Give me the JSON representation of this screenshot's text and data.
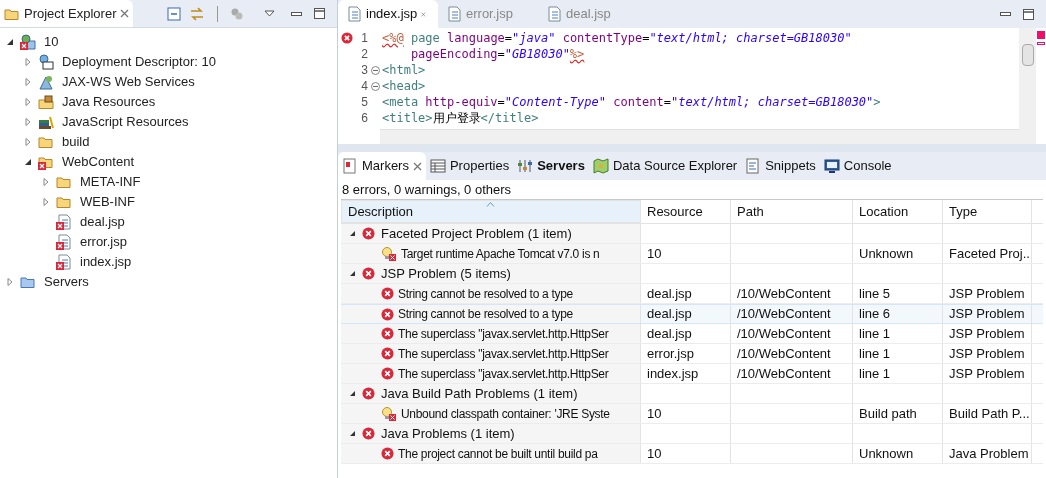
{
  "project_explorer": {
    "title": "Project Explorer",
    "tree": [
      {
        "label": "10",
        "kind": "project",
        "error": true,
        "expanded": true,
        "children": [
          {
            "label": "Deployment Descriptor: 10",
            "kind": "descriptor",
            "error": false,
            "expanded": false
          },
          {
            "label": "JAX-WS Web Services",
            "kind": "webservice",
            "error": false,
            "expanded": false
          },
          {
            "label": "Java Resources",
            "kind": "java-resources",
            "error": false,
            "expanded": false
          },
          {
            "label": "JavaScript Resources",
            "kind": "js-resources",
            "error": false,
            "expanded": false
          },
          {
            "label": "build",
            "kind": "folder",
            "error": false,
            "expanded": false
          },
          {
            "label": "WebContent",
            "kind": "folder",
            "error": true,
            "expanded": true,
            "children": [
              {
                "label": "META-INF",
                "kind": "folder",
                "error": false,
                "expanded": false
              },
              {
                "label": "WEB-INF",
                "kind": "folder",
                "error": false,
                "expanded": false
              },
              {
                "label": "deal.jsp",
                "kind": "file",
                "error": true
              },
              {
                "label": "error.jsp",
                "kind": "file",
                "error": true
              },
              {
                "label": "index.jsp",
                "kind": "file",
                "error": true
              }
            ]
          }
        ]
      },
      {
        "label": "Servers",
        "kind": "server-folder",
        "error": false,
        "expanded": false
      }
    ]
  },
  "editor": {
    "tabs": [
      {
        "label": "index.jsp",
        "selected": true
      },
      {
        "label": "error.jsp",
        "selected": false
      },
      {
        "label": "deal.jsp",
        "selected": false
      }
    ],
    "lines": [
      {
        "number": "1",
        "error": true,
        "fold": false,
        "tokens": [
          {
            "kind": "directive",
            "text": "<%@"
          },
          {
            "kind": "tag",
            "text": " page"
          },
          {
            "kind": "attr",
            "text": " language"
          },
          {
            "kind": "text",
            "text": "="
          },
          {
            "kind": "value",
            "text": "\"java\""
          },
          {
            "kind": "attr",
            "text": " contentType"
          },
          {
            "kind": "text",
            "text": "="
          },
          {
            "kind": "value",
            "text": "\"text/html; charset=GB18030\""
          }
        ]
      },
      {
        "number": "2",
        "error": false,
        "fold": false,
        "tokens": [
          {
            "kind": "attr",
            "text": "    pageEncoding"
          },
          {
            "kind": "text",
            "text": "="
          },
          {
            "kind": "value",
            "text": "\"GB18030\""
          },
          {
            "kind": "directive",
            "text": "%>"
          }
        ]
      },
      {
        "number": "3",
        "error": false,
        "fold": true,
        "tokens": [
          {
            "kind": "tag",
            "text": "<html>"
          }
        ]
      },
      {
        "number": "4",
        "error": false,
        "fold": true,
        "tokens": [
          {
            "kind": "tag",
            "text": "<head>"
          }
        ]
      },
      {
        "number": "5",
        "error": false,
        "fold": false,
        "tokens": [
          {
            "kind": "tag",
            "text": "<meta"
          },
          {
            "kind": "attr",
            "text": " http-equiv"
          },
          {
            "kind": "text",
            "text": "="
          },
          {
            "kind": "value",
            "text": "\"Content-Type\""
          },
          {
            "kind": "attr",
            "text": " content"
          },
          {
            "kind": "text",
            "text": "="
          },
          {
            "kind": "value",
            "text": "\"text/html; charset=GB18030\""
          },
          {
            "kind": "tag",
            "text": ">"
          }
        ]
      },
      {
        "number": "6",
        "error": false,
        "fold": false,
        "tokens": [
          {
            "kind": "tag",
            "text": "<title>"
          },
          {
            "kind": "text",
            "text": "用户登录"
          },
          {
            "kind": "tag",
            "text": "</title>"
          }
        ]
      }
    ]
  },
  "views": {
    "tabs": [
      {
        "label": "Markers",
        "kind": "markers",
        "selected": true,
        "highlighted": false
      },
      {
        "label": "Properties",
        "kind": "properties",
        "selected": false,
        "highlighted": false
      },
      {
        "label": "Servers",
        "kind": "servers",
        "selected": false,
        "highlighted": true
      },
      {
        "label": "Data Source Explorer",
        "kind": "datasource",
        "selected": false,
        "highlighted": false
      },
      {
        "label": "Snippets",
        "kind": "snippets",
        "selected": false,
        "highlighted": false
      },
      {
        "label": "Console",
        "kind": "console",
        "selected": false,
        "highlighted": false
      }
    ],
    "summary": "8 errors, 0 warnings, 0 others",
    "table": {
      "columns": [
        "Description",
        "Resource",
        "Path",
        "Location",
        "Type"
      ],
      "groups": [
        {
          "label": "Faceted Project Problem (1 item)",
          "expanded": true,
          "selected": false,
          "rows": [
            {
              "kind": "runtime-error",
              "description": "Target runtime Apache Tomcat v7.0 is n",
              "resource": "10",
              "path": "",
              "location": "Unknown",
              "type": "Faceted Proj...",
              "selected": false
            }
          ]
        },
        {
          "label": "JSP Problem (5 items)",
          "expanded": true,
          "selected": false,
          "rows": [
            {
              "kind": "error",
              "description": "String cannot be resolved to a type",
              "resource": "deal.jsp",
              "path": "/10/WebContent",
              "location": "line 5",
              "type": "JSP Problem",
              "selected": false
            },
            {
              "kind": "error",
              "description": "String cannot be resolved to a type",
              "resource": "deal.jsp",
              "path": "/10/WebContent",
              "location": "line 6",
              "type": "JSP Problem",
              "selected": true
            },
            {
              "kind": "error",
              "description": "The superclass \"javax.servlet.http.HttpSer",
              "resource": "deal.jsp",
              "path": "/10/WebContent",
              "location": "line 1",
              "type": "JSP Problem",
              "selected": false
            },
            {
              "kind": "error",
              "description": "The superclass \"javax.servlet.http.HttpSer",
              "resource": "error.jsp",
              "path": "/10/WebContent",
              "location": "line 1",
              "type": "JSP Problem",
              "selected": false
            },
            {
              "kind": "error",
              "description": "The superclass \"javax.servlet.http.HttpSer",
              "resource": "index.jsp",
              "path": "/10/WebContent",
              "location": "line 1",
              "type": "JSP Problem",
              "selected": false
            }
          ]
        },
        {
          "label": "Java Build Path Problems (1 item)",
          "expanded": true,
          "selected": false,
          "rows": [
            {
              "kind": "runtime-error",
              "description": "Unbound classpath container: 'JRE Syste",
              "resource": "10",
              "path": "",
              "location": "Build path",
              "type": "Build Path P...",
              "selected": false
            }
          ]
        },
        {
          "label": "Java Problems (1 item)",
          "expanded": true,
          "selected": false,
          "rows": [
            {
              "kind": "error",
              "description": "The project cannot be built until build pa",
              "resource": "10",
              "path": "",
              "location": "Unknown",
              "type": "Java Problem",
              "selected": false
            }
          ]
        }
      ]
    }
  }
}
